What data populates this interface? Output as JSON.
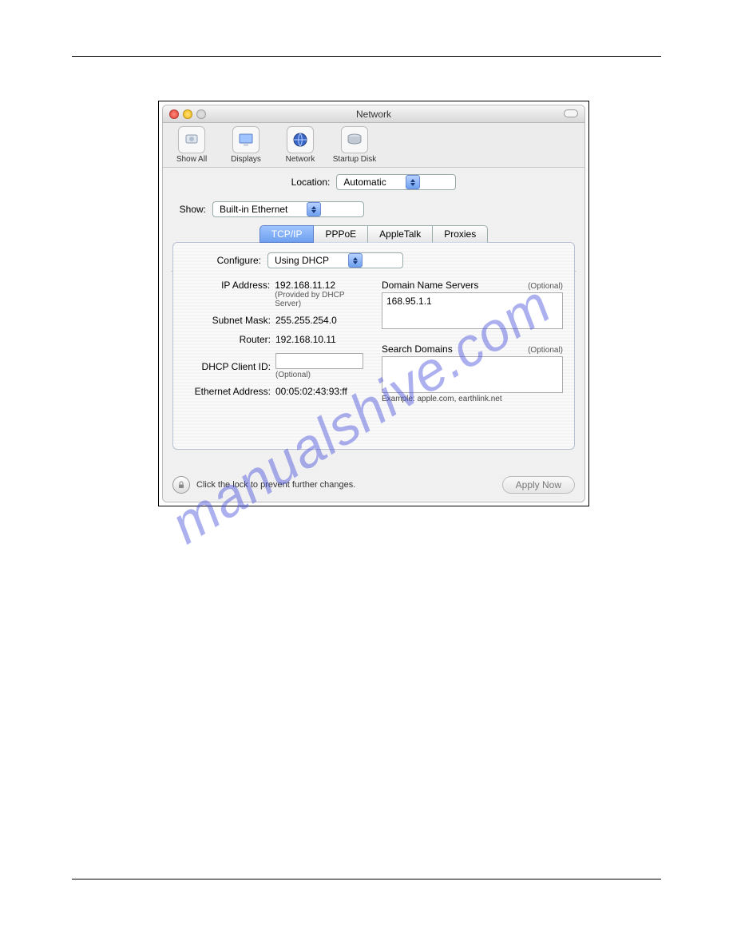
{
  "window": {
    "title": "Network"
  },
  "toolbar": {
    "show_all": "Show All",
    "displays": "Displays",
    "network": "Network",
    "startup_disk": "Startup Disk"
  },
  "location": {
    "label": "Location:",
    "value": "Automatic"
  },
  "show": {
    "label": "Show:",
    "value": "Built-in Ethernet"
  },
  "tabs": {
    "tcpip": "TCP/IP",
    "pppoe": "PPPoE",
    "appletalk": "AppleTalk",
    "proxies": "Proxies"
  },
  "configure": {
    "label": "Configure:",
    "value": "Using DHCP"
  },
  "left": {
    "ip_label": "IP Address:",
    "ip_value": "192.168.11.12",
    "ip_note": "(Provided by DHCP Server)",
    "subnet_label": "Subnet Mask:",
    "subnet_value": "255.255.254.0",
    "router_label": "Router:",
    "router_value": "192.168.10.11",
    "dhcp_label": "DHCP Client ID:",
    "dhcp_value": "",
    "dhcp_note": "(Optional)",
    "eth_label": "Ethernet Address:",
    "eth_value": "00:05:02:43:93:ff"
  },
  "right": {
    "dns_label": "Domain Name Servers",
    "dns_optional": "(Optional)",
    "dns_value": "168.95.1.1",
    "search_label": "Search Domains",
    "search_optional": "(Optional)",
    "search_value": "",
    "example": "Example: apple.com, earthlink.net"
  },
  "footer": {
    "lock_text": "Click the lock to prevent further changes.",
    "apply": "Apply Now"
  },
  "watermark": "manualshive.com"
}
